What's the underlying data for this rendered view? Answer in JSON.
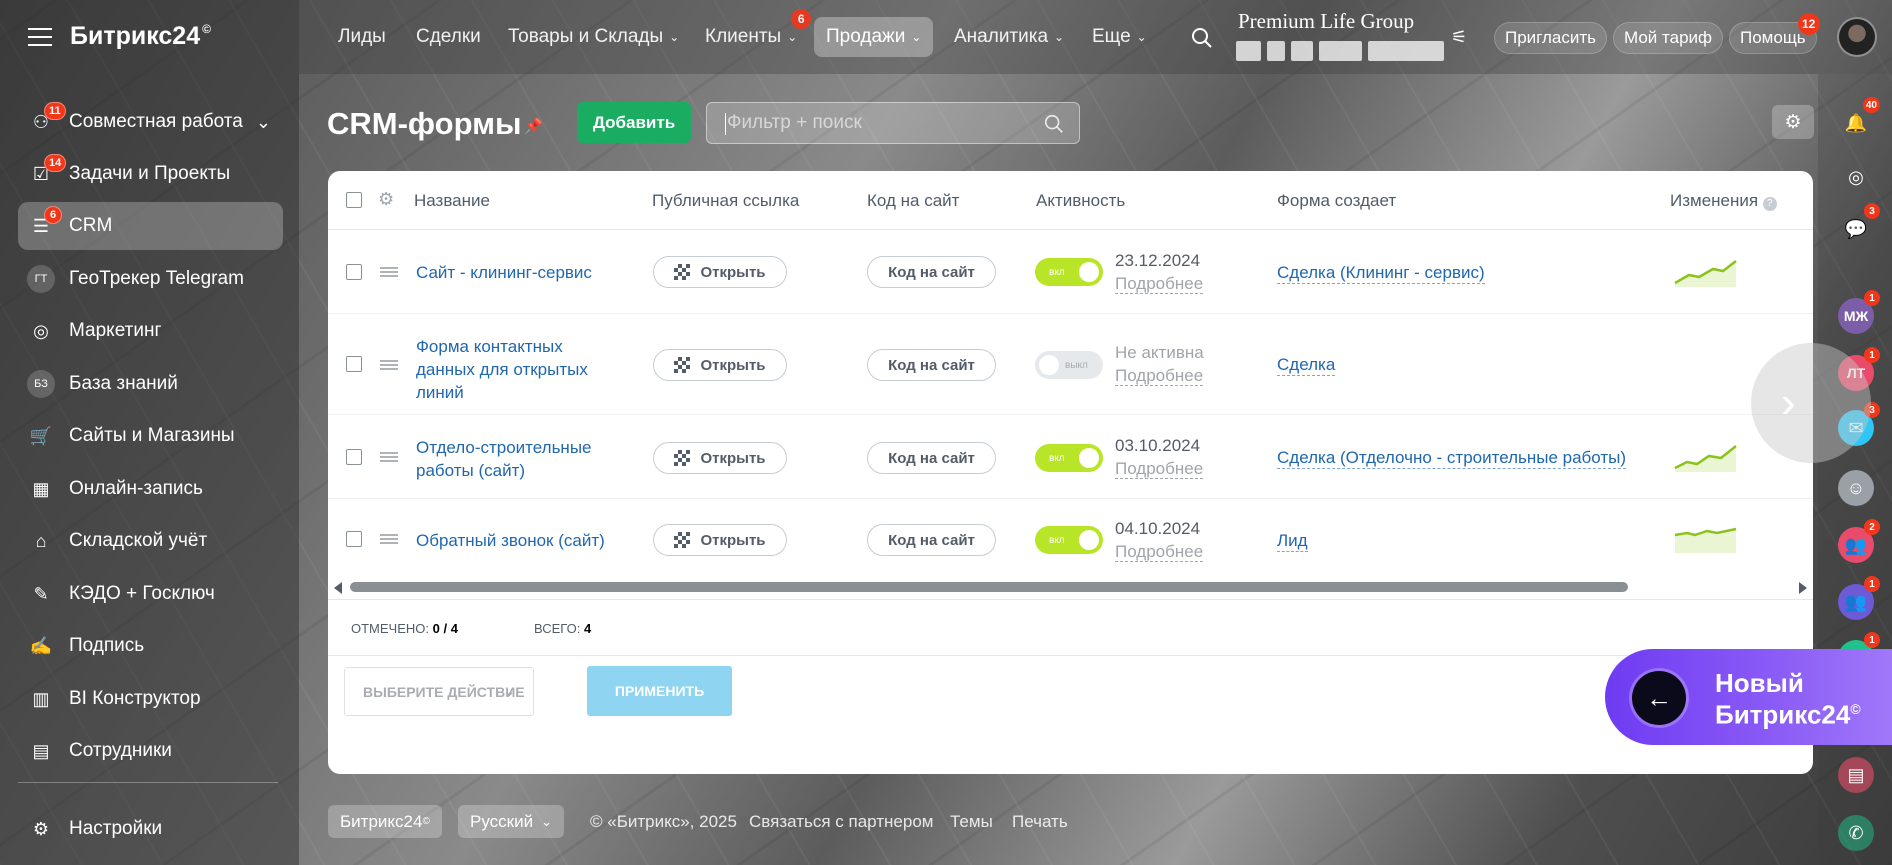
{
  "app": {
    "logo": "Битрикс24",
    "logo_mark": "©"
  },
  "sidebar": {
    "items": [
      {
        "label": "Совместная работа",
        "icon": "collaboration-icon",
        "badge": "11"
      },
      {
        "label": "Задачи и Проекты",
        "icon": "tasks-icon",
        "badge": "14"
      },
      {
        "label": "CRM",
        "icon": "crm-icon",
        "badge": "6"
      },
      {
        "label": "ГеоТрекер Telegram",
        "icon": "avatar-gt",
        "avatar_text": "ГТ"
      },
      {
        "label": "Маркетинг",
        "icon": "marketing-icon"
      },
      {
        "label": "База знаний",
        "icon": "avatar-bz",
        "avatar_text": "БЗ"
      },
      {
        "label": "Сайты и Магазины",
        "icon": "cart-icon"
      },
      {
        "label": "Онлайн-запись",
        "icon": "calendar-icon"
      },
      {
        "label": "Складской учёт",
        "icon": "warehouse-icon"
      },
      {
        "label": "КЭДО + Госключ",
        "icon": "document-icon"
      },
      {
        "label": "Подпись",
        "icon": "pen-icon"
      },
      {
        "label": "BI Конструктор",
        "icon": "bar-chart-icon"
      },
      {
        "label": "Сотрудники",
        "icon": "employees-icon"
      }
    ],
    "settings": "Настройки"
  },
  "topnav": {
    "items": [
      "Лиды",
      "Сделки",
      "Товары и Склады",
      "Клиенты",
      "Продажи",
      "Аналитика",
      "Еще"
    ],
    "clients_badge": "6",
    "company": "Premium Life Group",
    "invite": "Пригласить",
    "tariff": "Мой тариф",
    "help": "Помощь",
    "help_badge": "12"
  },
  "page": {
    "title": "CRM-формы",
    "add_button": "Добавить",
    "filter_placeholder": "Фильтр + поиск"
  },
  "table": {
    "columns": [
      "Название",
      "Публичная ссылка",
      "Код на сайт",
      "Активность",
      "Форма создает",
      "Изменения"
    ],
    "rows": [
      {
        "name": "Сайт - клининг-сервис",
        "open": "Открыть",
        "code": "Код на сайт",
        "toggle": "вкл",
        "active": true,
        "date": "23.12.2024",
        "more": "Подробнее",
        "entity": "Сделка (Клининг - сервис)"
      },
      {
        "name": "Форма контактных данных для открытых линий",
        "open": "Открыть",
        "code": "Код на сайт",
        "toggle": "выкл",
        "active": false,
        "date": "Не активна",
        "more": "Подробнее",
        "entity": "Сделка"
      },
      {
        "name": "Отдело-строительные работы (сайт)",
        "open": "Открыть",
        "code": "Код на сайт",
        "toggle": "вкл",
        "active": true,
        "date": "03.10.2024",
        "more": "Подробнее",
        "entity": "Сделка (Отделочно - строительные работы)"
      },
      {
        "name": "Обратный звонок (сайт)",
        "open": "Открыть",
        "code": "Код на сайт",
        "toggle": "вкл",
        "active": true,
        "date": "04.10.2024",
        "more": "Подробнее",
        "entity": "Лид"
      }
    ],
    "selected_label": "ОТМЕЧЕНО:",
    "selected_value": "0 / 4",
    "total_label": "ВСЕГО:",
    "total_value": "4",
    "action_placeholder": "ВЫБЕРИТЕ ДЕЙСТВИЕ",
    "apply": "ПРИМЕНИТЬ"
  },
  "rightbar": {
    "notifications_badge": "40",
    "chat_badge": "3",
    "avatars": [
      {
        "text": "МЖ",
        "badge": "1",
        "color": "#7b5ea7"
      },
      {
        "text": "ЛТ",
        "badge": "1",
        "color": "#e84c6a"
      }
    ],
    "group_badges": [
      "3",
      "2",
      "1",
      "1"
    ]
  },
  "promo": {
    "line1": "Новый",
    "line2": "Битрикс24",
    "mark": "©"
  },
  "footer": {
    "brand": "Битрикс24",
    "mark": "©",
    "language": "Русский",
    "copyright": "© «Битрикс», 2025",
    "partner": "Связаться с партнером",
    "themes": "Темы",
    "print": "Печать"
  },
  "colors": {
    "accent_green": "#1aad61",
    "link_blue": "#2067b0",
    "toggle_on": "#b8e527",
    "badge_red": "#f0371b",
    "promo_violet": "#8b5cf6"
  }
}
